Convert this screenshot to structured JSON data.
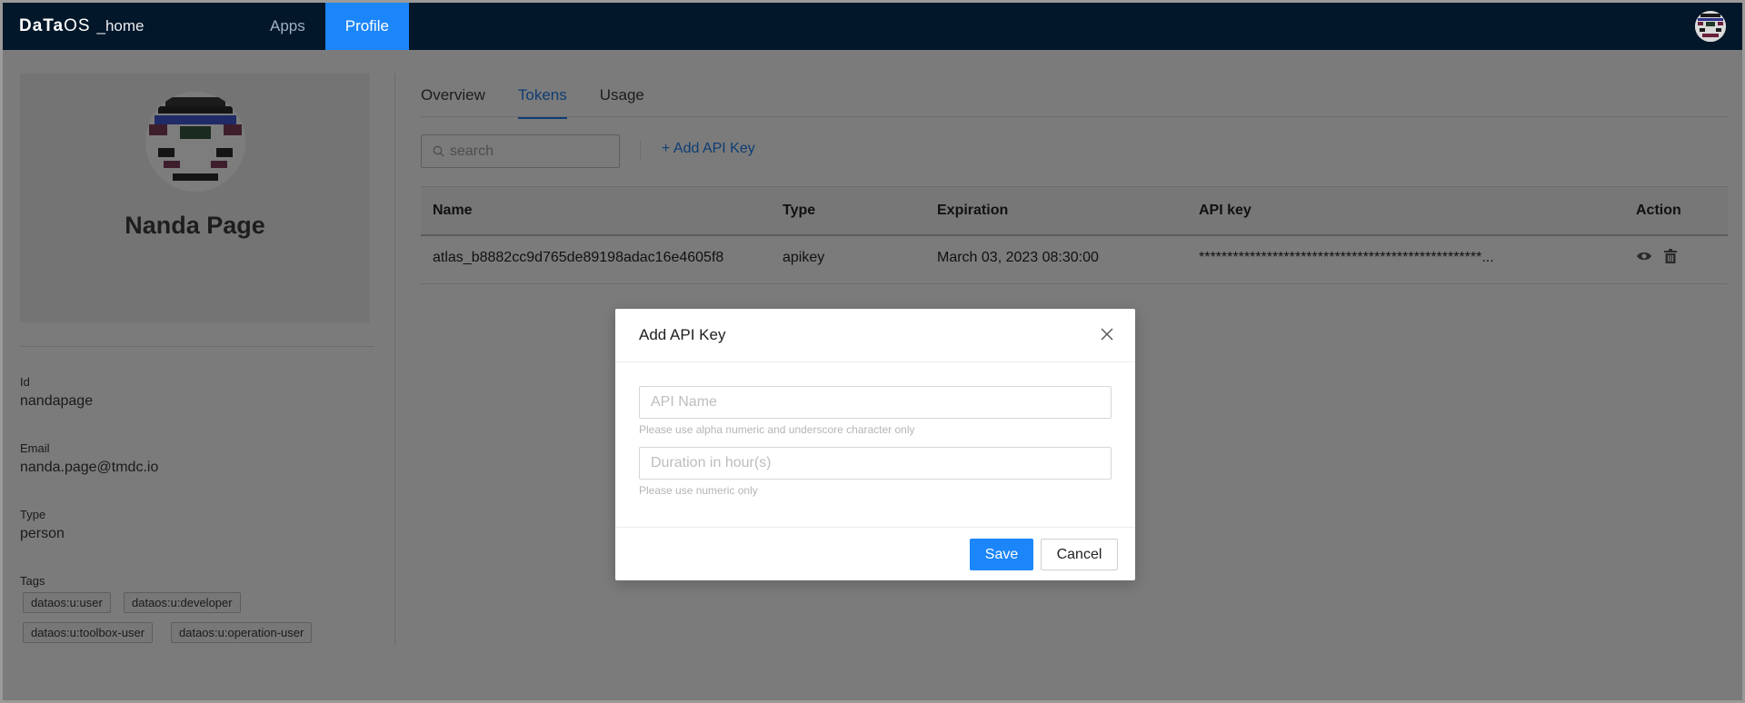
{
  "nav": {
    "brand_bold": "DaTa",
    "brand_light": "OS",
    "brand_suffix": "_home",
    "links": [
      {
        "label": "Apps"
      },
      {
        "label": "Profile"
      }
    ]
  },
  "profile": {
    "name": "Nanda Page",
    "fields": {
      "id_label": "Id",
      "id_value": "nandapage",
      "email_label": "Email",
      "email_value": "nanda.page@tmdc.io",
      "type_label": "Type",
      "type_value": "person",
      "tags_label": "Tags"
    },
    "tags": [
      "dataos:u:user",
      "dataos:u:developer",
      "dataos:u:toolbox-user",
      "dataos:u:operation-user"
    ]
  },
  "tabs": [
    {
      "label": "Overview"
    },
    {
      "label": "Tokens"
    },
    {
      "label": "Usage"
    }
  ],
  "toolbar": {
    "search_placeholder": "search",
    "add_key_label": "+ Add API Key"
  },
  "table": {
    "columns": [
      "Name",
      "Type",
      "Expiration",
      "API key",
      "Action"
    ],
    "rows": [
      {
        "name": "atlas_b8882cc9d765de89198adac16e4605f8",
        "type": "apikey",
        "expiration": "March 03, 2023 08:30:00",
        "api_key": "**************************************************..."
      }
    ]
  },
  "modal": {
    "title": "Add API Key",
    "api_name_placeholder": "API Name",
    "api_name_hint": "Please use alpha numeric and underscore character only",
    "duration_placeholder": "Duration in hour(s)",
    "duration_hint": "Please use numeric only",
    "save_label": "Save",
    "cancel_label": "Cancel"
  },
  "colors": {
    "nav_bg": "#03172a",
    "accent": "#1b86f9",
    "overlay": "#7b7b7b"
  }
}
